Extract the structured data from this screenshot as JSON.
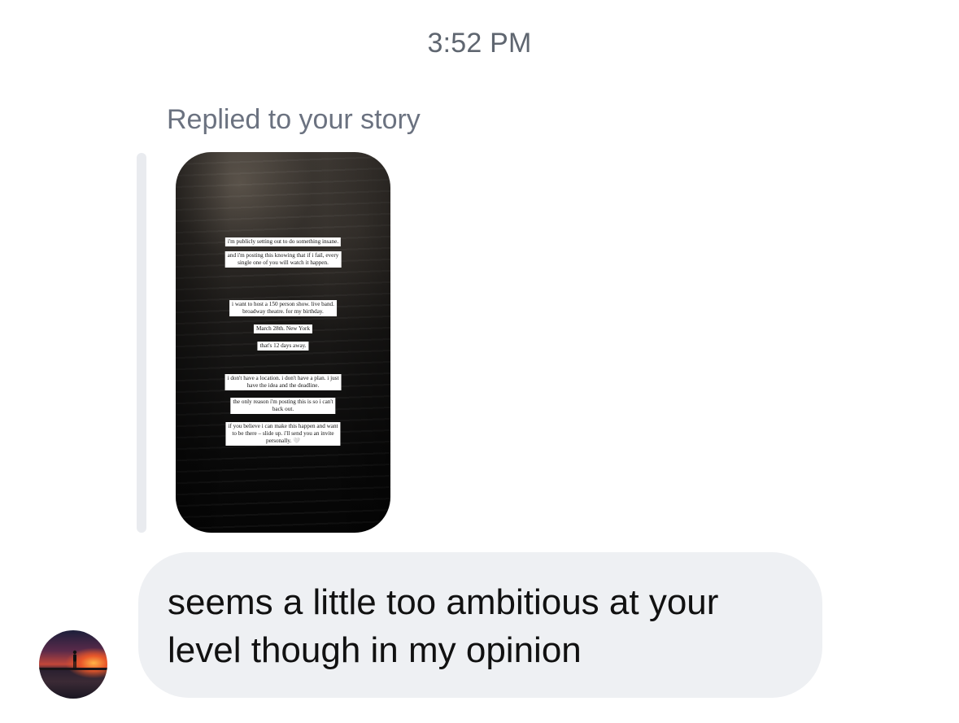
{
  "timestamp": "3:52 PM",
  "reply_label": "Replied to your story",
  "story": {
    "captions": [
      "i'm publicly setting out to do something insane.",
      "and i'm posting this knowing that if i fail, every",
      "single one of you will watch it happen.",
      "i want to host a 150 person show. live band.",
      "broadway theatre. for my birthday.",
      "March 28th. New York",
      "that's 12 days away.",
      "i don't have a location. i don't have a plan. i just",
      "have the idea and the deadline.",
      "the only reason i'm posting this is so i can't",
      "back out.",
      "if you believe i can make this happen and want",
      "to be there – slide up. i'll send you an invite",
      "personally. 🤍"
    ]
  },
  "message": {
    "text": "seems a little too ambitious at your level though in my opinion"
  },
  "avatar": {
    "icon": "sunset-silhouette-avatar"
  }
}
